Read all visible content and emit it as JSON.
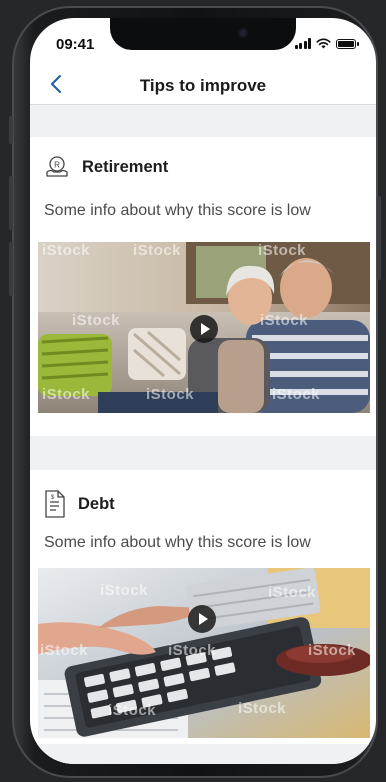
{
  "status_bar": {
    "time": "09:41"
  },
  "nav": {
    "title": "Tips to improve"
  },
  "sections": [
    {
      "title": "Retirement",
      "info": "Some info about why this score is low",
      "icon": "retirement-icon",
      "watermark": "iStock"
    },
    {
      "title": "Debt",
      "info": "Some info about why this score is low",
      "icon": "document-icon",
      "watermark": "iStock"
    }
  ],
  "colors": {
    "accent": "#1e5aa8",
    "band": "#f0f1f3",
    "text": "#1d1d1d",
    "muted": "#4b4b4b"
  }
}
